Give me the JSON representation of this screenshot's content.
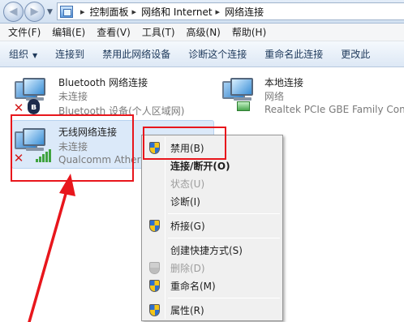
{
  "address_bar": {
    "breadcrumbs": [
      "控制面板",
      "网络和 Internet",
      "网络连接"
    ],
    "separator": "▸"
  },
  "menu": [
    "文件(F)",
    "编辑(E)",
    "查看(V)",
    "工具(T)",
    "高级(N)",
    "帮助(H)"
  ],
  "commands": [
    "组织",
    "连接到",
    "禁用此网络设备",
    "诊断这个连接",
    "重命名此连接",
    "更改此"
  ],
  "connections": {
    "bluetooth": {
      "name": "Bluetooth 网络连接",
      "status": "未连接",
      "device": "Bluetooth 设备(个人区域网)"
    },
    "local": {
      "name": "本地连接",
      "status": "网络",
      "device": "Realtek PCIe GBE Family Contr"
    },
    "wireless": {
      "name": "无线网络连接",
      "status": "未连接",
      "device": "Qualcomm Atheros"
    }
  },
  "context_menu": {
    "disable": "禁用(B)",
    "connect": "连接/断开(O)",
    "status": "状态(U)",
    "diagnose": "诊断(I)",
    "bridge": "桥接(G)",
    "shortcut": "创建快捷方式(S)",
    "delete": "删除(D)",
    "rename": "重命名(M)",
    "properties": "属性(R)"
  },
  "colors": {
    "annotation_red": "#e8161c",
    "selection": "#dbe9f9"
  },
  "icons": {
    "nav": [
      "back-arrow-icon",
      "forward-arrow-icon"
    ],
    "address": "control-panel-icon",
    "connection": "network-computer-icon",
    "badges": [
      "red-x-disconnected-icon",
      "bluetooth-icon",
      "wifi-signal-icon",
      "ethernet-plug-icon"
    ],
    "menu": "uac-shield-icon"
  }
}
